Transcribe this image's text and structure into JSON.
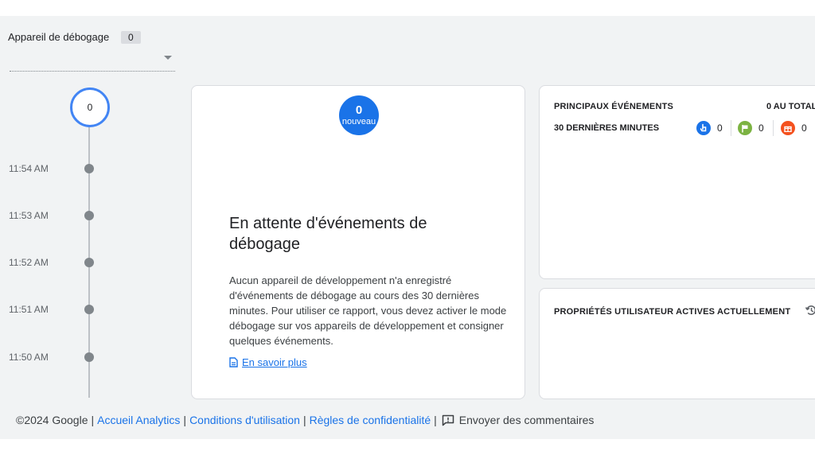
{
  "device": {
    "label": "Appareil de débogage",
    "count": "0"
  },
  "timeline": {
    "top_count": "0",
    "ticks": [
      "11:54 AM",
      "11:53 AM",
      "11:52 AM",
      "11:51 AM",
      "11:50 AM"
    ]
  },
  "main": {
    "new_count": "0",
    "new_label": "nouveau",
    "title": "En attente d'événements de débogage",
    "body": "Aucun appareil de développement n'a enregistré d'événements de débogage au cours des 30 dernières minutes. Pour utiliser ce rapport, vous devez activer le mode débogage sur vos appareils de développement et consigner quelques événements.",
    "learn_more": "En savoir plus"
  },
  "events": {
    "title": "PRINCIPAUX ÉVÉNEMENTS",
    "total": "0 AU TOTAL",
    "subtitle": "30 DERNIÈRES MINUTES",
    "badges": [
      {
        "icon": "touch-icon",
        "color": "#1a73e8",
        "count": "0"
      },
      {
        "icon": "flag-icon",
        "color": "#7cb342",
        "count": "0"
      },
      {
        "icon": "gift-icon",
        "color": "#f4511e",
        "count": "0"
      }
    ]
  },
  "properties": {
    "title": "PROPRIÉTÉS UTILISATEUR ACTIVES ACTUELLEMENT"
  },
  "footer": {
    "copyright": "©2024 Google",
    "home": "Accueil Analytics",
    "terms": "Conditions d'utilisation",
    "privacy": "Règles de confidentialité",
    "feedback": "Envoyer des commentaires"
  },
  "colors": {
    "accent": "#1a73e8",
    "timeline_ring": "#4285f4"
  }
}
